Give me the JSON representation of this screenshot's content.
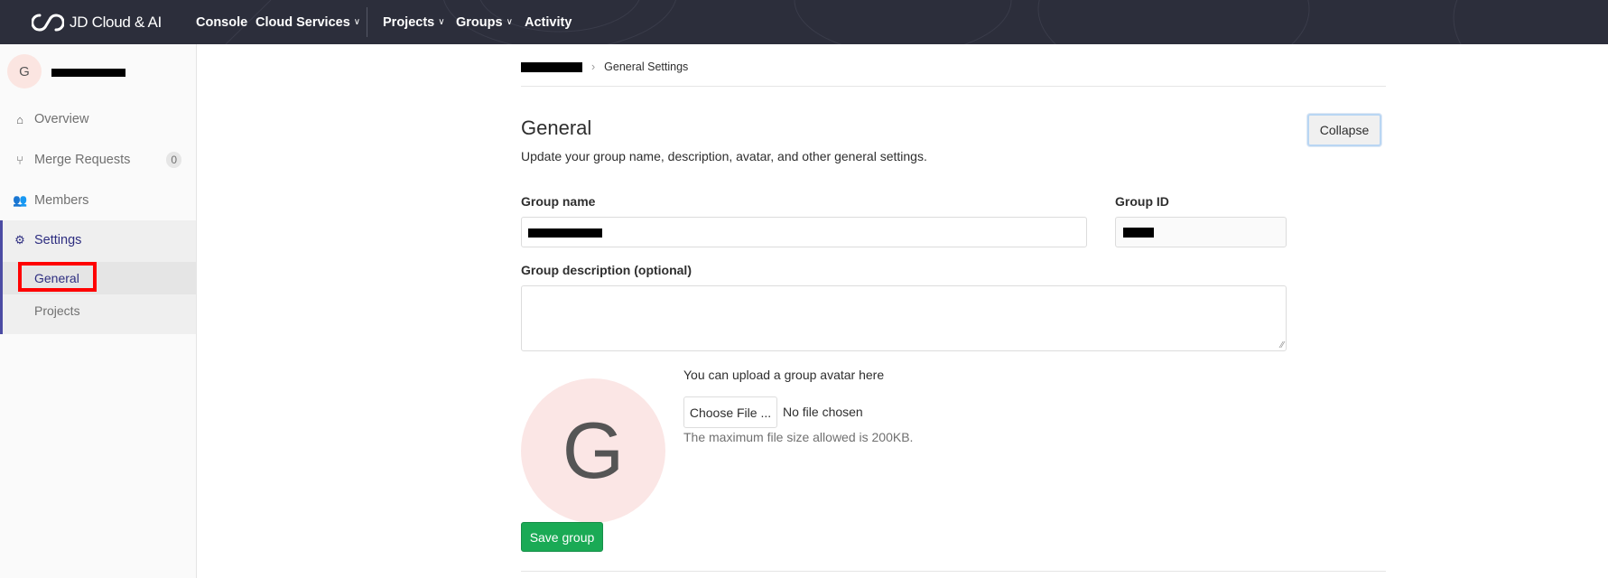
{
  "topbar": {
    "brand": "JD Cloud & AI",
    "nav": [
      {
        "label": "Console",
        "dropdown": false
      },
      {
        "label": "Cloud Services",
        "dropdown": true
      },
      {
        "label": "Projects",
        "dropdown": true
      },
      {
        "label": "Groups",
        "dropdown": true
      },
      {
        "label": "Activity",
        "dropdown": false
      }
    ]
  },
  "sidebar": {
    "group_initial": "G",
    "items": [
      {
        "label": "Overview",
        "icon": "home-icon"
      },
      {
        "label": "Merge Requests",
        "icon": "merge-request-icon",
        "badge": "0"
      },
      {
        "label": "Members",
        "icon": "users-icon"
      },
      {
        "label": "Settings",
        "icon": "gear-icon"
      }
    ],
    "settings_sub": [
      {
        "label": "General",
        "active": true
      },
      {
        "label": "Projects",
        "active": false
      }
    ]
  },
  "breadcrumb": {
    "separator": "›",
    "current": "General Settings"
  },
  "section": {
    "title": "General",
    "collapse_label": "Collapse",
    "description": "Update your group name, description, avatar, and other general settings."
  },
  "form": {
    "group_name_label": "Group name",
    "group_id_label": "Group ID",
    "description_label": "Group description (optional)",
    "description_value": "",
    "avatar_initial": "G",
    "avatar_hint": "You can upload a group avatar here",
    "choose_file_label": "Choose File ...",
    "no_file_text": "No file chosen",
    "max_size_text": "The maximum file size allowed is 200KB.",
    "save_label": "Save group"
  },
  "colors": {
    "topbar": "#2c2e3b",
    "accent": "#4b4ba3",
    "save": "#1aaa55",
    "highlight": "#ff0000"
  }
}
